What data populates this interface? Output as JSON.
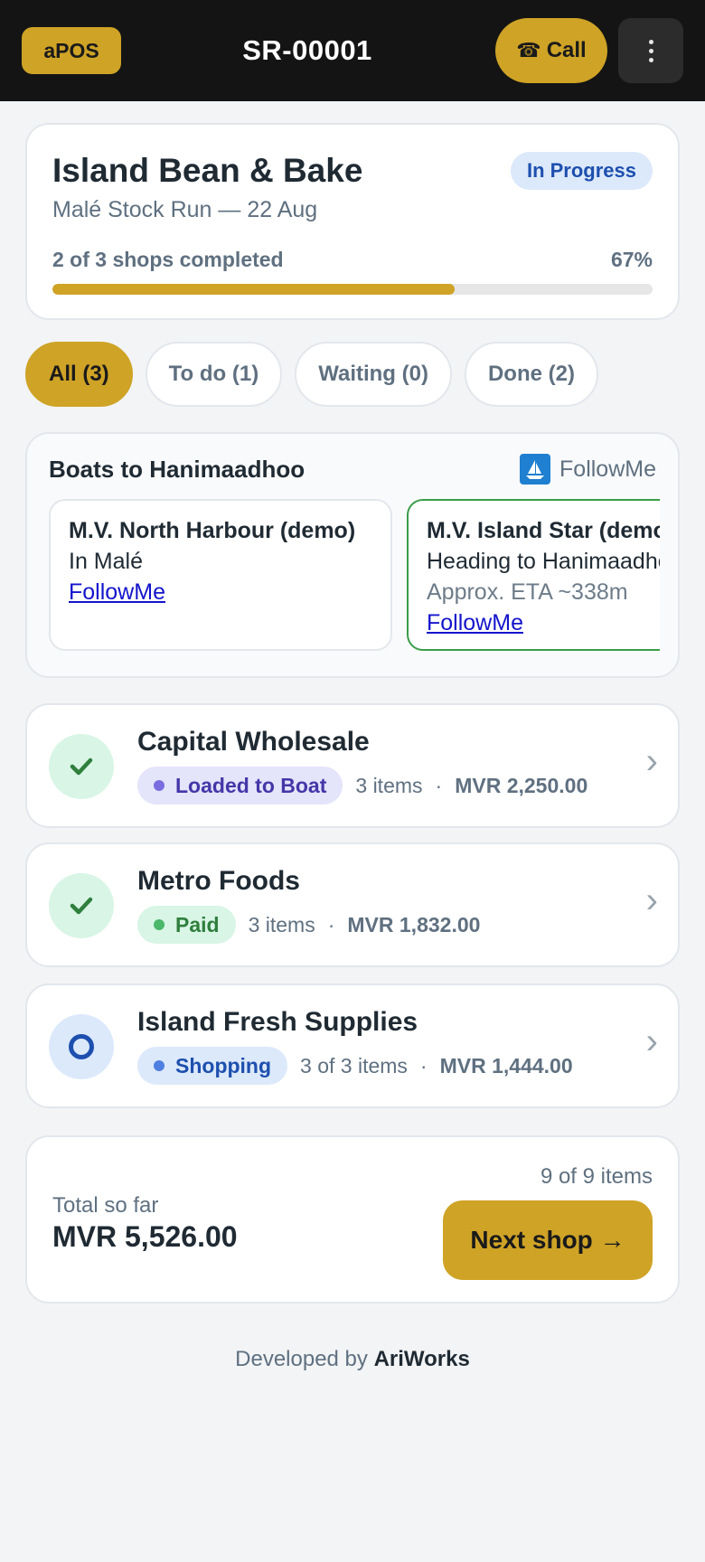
{
  "header": {
    "brand": "aPOS",
    "order_id": "SR-00001",
    "call_label": "Call",
    "call_glyph": "☎",
    "menu_icon": "more-vertical-icon"
  },
  "summary": {
    "title": "Island Bean & Bake",
    "subtitle": "Malé Stock Run — 22 Aug",
    "status": "In Progress",
    "progress_label": "2 of 3 shops completed",
    "progress_pct_label": "67%",
    "progress_fraction": 0.67
  },
  "filters": [
    {
      "label": "All (3)",
      "active": true
    },
    {
      "label": "To do (1)",
      "active": false
    },
    {
      "label": "Waiting (0)",
      "active": false
    },
    {
      "label": "Done (2)",
      "active": false
    }
  ],
  "boats": {
    "title": "Boats to Hanimaadhoo",
    "brand": "FollowMe",
    "items": [
      {
        "name": "M.V. North Harbour (demo)",
        "status": "In Malé",
        "link": "FollowMe"
      },
      {
        "name": "M.V. Island Star (demo)",
        "status": "Heading to Hanimaadhoo",
        "eta": "Approx. ETA ~338m",
        "link": "FollowMe"
      }
    ]
  },
  "shops": [
    {
      "name": "Capital Wholesale",
      "tag": "Loaded to Boat",
      "items": "3 items",
      "amount": "MVR 2,250.00",
      "state": "done"
    },
    {
      "name": "Metro Foods",
      "tag": "Paid",
      "items": "3 items",
      "amount": "MVR 1,832.00",
      "state": "done"
    },
    {
      "name": "Island Fresh Supplies",
      "tag": "Shopping",
      "items": "3 of 3 items",
      "amount": "MVR 1,444.00",
      "state": "todo"
    }
  ],
  "shop_separator": "·",
  "chevron": "›",
  "total": {
    "items_count": "9 of 9 items",
    "label": "Total so far",
    "value": "MVR 5,526.00",
    "next_label": "Next shop →"
  },
  "footer": {
    "prefix": "Developed by",
    "brand": "AriWorks"
  },
  "colors": {
    "accent": "#cfa326",
    "topbar": "#141414",
    "status_blue": "#1d4fae",
    "success_green": "#2f7f3d",
    "loaded_purple": "#4536a8"
  }
}
